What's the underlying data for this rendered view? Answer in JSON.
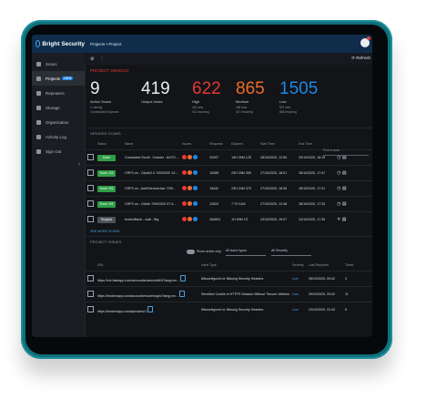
{
  "brand": {
    "name": "Bright Security"
  },
  "sidebar": {
    "items": [
      {
        "label": "Scans",
        "icon": "scan-icon"
      },
      {
        "label": "Projects",
        "icon": "folder-icon",
        "badge": "NEW"
      },
      {
        "label": "Repeaters",
        "icon": "repeater-icon"
      },
      {
        "label": "Storage",
        "icon": "storage-icon"
      },
      {
        "label": "Organization",
        "icon": "building-icon"
      },
      {
        "label": "Activity Log",
        "icon": "list-icon"
      },
      {
        "label": "Sign Out",
        "icon": "logout-icon"
      }
    ]
  },
  "header": {
    "breadcrumb": "Projects • Project"
  },
  "toolbar": {
    "refresh_label": "Refresh"
  },
  "project_label": "PROJECT: DEMOLO",
  "stats": {
    "active_scans": {
      "value": "9",
      "label": "Active Scans",
      "sub1": "1 running",
      "sub2": "0 scheduled  8 queued"
    },
    "unique_hosts": {
      "value": "419",
      "label": "Unique hosts"
    },
    "high": {
      "value": "622",
      "label": "High",
      "sub1": "431 new",
      "sub2": "411 recurring",
      "color": "#e53935"
    },
    "medium": {
      "value": "865",
      "label": "Medium",
      "sub1": "448 new",
      "sub2": "417 recurring",
      "color": "#ef6c27"
    },
    "low": {
      "value": "1505",
      "label": "Low",
      "sub1": "697 new",
      "sub2": "808 recurring",
      "color": "#1e88e5"
    }
  },
  "scans": {
    "title": "UPDATED SCANS",
    "search_placeholder": "Find a scan",
    "columns": [
      "Status",
      "Name",
      "Issues",
      "Requests",
      "Elapsed",
      "Start Time",
      "End Time"
    ],
    "rows": [
      {
        "status": "Done",
        "status_color": "green",
        "name": "Connected Scroll - Crawler - AUTO...",
        "issues": [
          "2",
          "1",
          "3"
        ],
        "requests": "20397",
        "elapsed": "14H 39M 12S",
        "start": "28/10/2020, 12:55",
        "end": "29/10/2020, 18:15"
      },
      {
        "status": "Done √33",
        "status_color": "green",
        "name": "CRFS on - OAuth2.0 7/09/2020 12:...",
        "issues": [
          "0",
          "0",
          "0"
        ],
        "requests": "15455",
        "elapsed": "23H 25M 35S",
        "start": "27/10/2020, 18:01",
        "end": "28/10/2020, 17:47"
      },
      {
        "status": "Done √33",
        "status_color": "green",
        "name": "CRFS on - AuthServiceUser 7/09...",
        "issues": [
          "0",
          "0",
          "0"
        ],
        "requests": "15442",
        "elapsed": "23H 24M 37S",
        "start": "27/10/2020, 18:06",
        "end": "28/10/2020, 17:31"
      },
      {
        "status": "Done √33",
        "status_color": "green",
        "name": "CRFS on - OAuth 7/09/2020 07:4...",
        "issues": [
          "0",
          "0",
          "0"
        ],
        "requests": "12524",
        "elapsed": "7 7H 11M",
        "start": "27/10/2020, 12:38",
        "end": "28/10/2020, 17:33"
      },
      {
        "status": "Stopped",
        "status_color": "gray",
        "name": "brokenBank - watt - Big",
        "issues": [
          "2",
          "1",
          "3"
        ],
        "requests": "284603",
        "elapsed": "1H 59M 1S",
        "start": "24/10/2020, 15:07",
        "end": "24/10/2020, 17:35"
      }
    ],
    "more_label": "SEE MORE SCANS"
  },
  "issues": {
    "title": "PROJECT ISSUES",
    "toggle_label": "Show active only",
    "type_filter": "All issue types",
    "severity_filter": "All Severity",
    "columns": [
      "URL",
      "Issue Type",
      "Severity",
      "Last Reported",
      "Times"
    ],
    "rows": [
      {
        "url": "https://crk.fakeapp.com/accounts/users/edit/4?lang=en...",
        "type": "Misconfigured or Missing Security Headers",
        "severity": "Low",
        "last": "28/10/2020, 09:42",
        "times": "3"
      },
      {
        "url": "https://brokenapp.com/account/ensure/login/?lang=en...",
        "type": "Sensitive Cookie in HTTPS Session Without 'Secure' Attribute",
        "severity": "Low",
        "last": "29/10/2020, 09:42",
        "times": "11"
      },
      {
        "url": "https://brokenapp.com/api/users/1",
        "type": "Misconfigured or Missing Security Headers",
        "severity": "Low",
        "last": "23/10/2020, 01:43",
        "times": "6"
      }
    ]
  }
}
